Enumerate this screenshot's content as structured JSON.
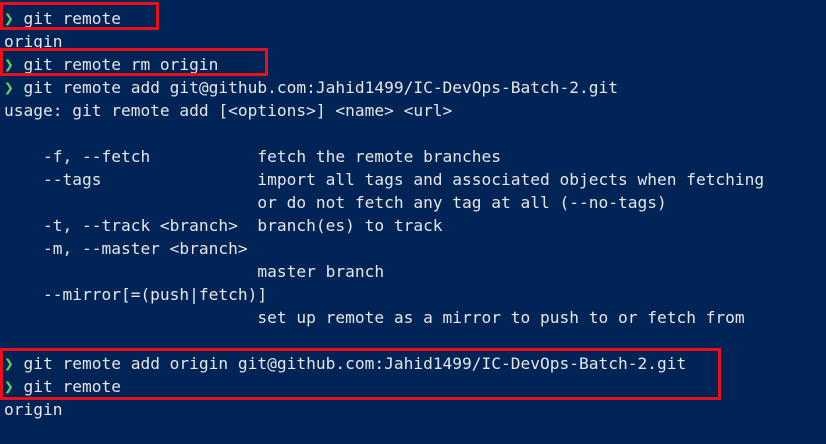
{
  "theme": {
    "background": "#012456",
    "text": "#e6e6e6",
    "prompt": "#5fd75f",
    "highlight": "#e8101a"
  },
  "prompt_symbol": "❯",
  "lines": [
    {
      "type": "command",
      "text": " git remote"
    },
    {
      "type": "output",
      "text": "origin"
    },
    {
      "type": "command",
      "text": " git remote rm origin"
    },
    {
      "type": "command",
      "text": " git remote add git@github.com:Jahid1499/IC-DevOps-Batch-2.git"
    },
    {
      "type": "output",
      "text": "usage: git remote add [<options>] <name> <url>"
    },
    {
      "type": "output",
      "text": ""
    },
    {
      "type": "output",
      "text": "    -f, --fetch           fetch the remote branches"
    },
    {
      "type": "output",
      "text": "    --tags                import all tags and associated objects when fetching"
    },
    {
      "type": "output",
      "text": "                          or do not fetch any tag at all (--no-tags)"
    },
    {
      "type": "output",
      "text": "    -t, --track <branch>  branch(es) to track"
    },
    {
      "type": "output",
      "text": "    -m, --master <branch>"
    },
    {
      "type": "output",
      "text": "                          master branch"
    },
    {
      "type": "output",
      "text": "    --mirror[=(push|fetch)]"
    },
    {
      "type": "output",
      "text": "                          set up remote as a mirror to push to or fetch from"
    },
    {
      "type": "output",
      "text": ""
    },
    {
      "type": "command",
      "text": " git remote add origin git@github.com:Jahid1499/IC-DevOps-Batch-2.git"
    },
    {
      "type": "command",
      "text": " git remote"
    },
    {
      "type": "output",
      "text": "origin"
    }
  ]
}
